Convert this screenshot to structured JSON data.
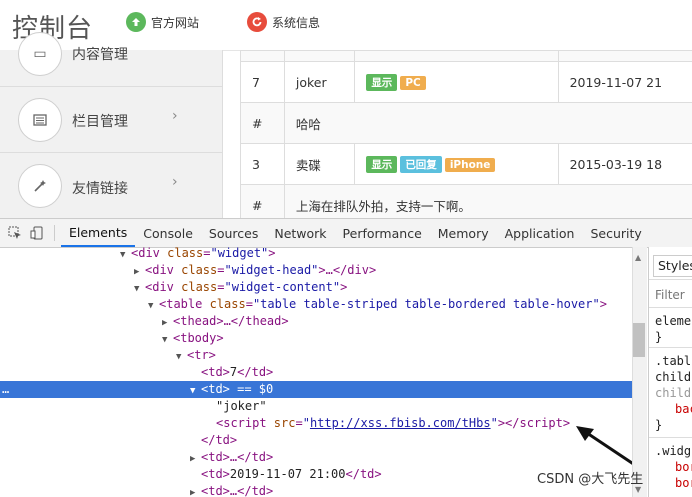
{
  "header": {
    "app_title": "控制台",
    "links": [
      {
        "label": "官方网站",
        "icon": "cloud-upload-icon",
        "color": "#5cb85c"
      },
      {
        "label": "系统信息",
        "icon": "refresh-icon",
        "color": "#e74c3c"
      }
    ]
  },
  "sidebar": {
    "items": [
      {
        "label": "内容管理",
        "icon": "content-icon"
      },
      {
        "label": "栏目管理",
        "icon": "list-icon"
      },
      {
        "label": "友情链接",
        "icon": "magic-wand-icon"
      }
    ],
    "chevron": "›"
  },
  "comments_table": {
    "rows": [
      {
        "col1": "7",
        "col2": "joker",
        "badges": [
          {
            "text": "显示",
            "color": "#5cb85c"
          },
          {
            "text": "PC",
            "color": "#f0ad4e"
          }
        ],
        "date": "2019-11-07 21"
      },
      {
        "col1": "#",
        "col2": "哈哈",
        "badges": [],
        "date": ""
      },
      {
        "col1": "3",
        "col2": "卖碟",
        "badges": [
          {
            "text": "显示",
            "color": "#5cb85c"
          },
          {
            "text": "已回复",
            "color": "#5bc0de"
          },
          {
            "text": "iPhone",
            "color": "#f0ad4e"
          }
        ],
        "date": "2015-03-19 18"
      },
      {
        "col1": "#",
        "col2": "上海在排队外拍，支持一下啊。",
        "badges": [],
        "date": ""
      }
    ]
  },
  "devtools": {
    "tabs": [
      "Elements",
      "Console",
      "Sources",
      "Network",
      "Performance",
      "Memory",
      "Application",
      "Security"
    ],
    "active_tab": "Elements",
    "selected_suffix": " == $0",
    "script_src": "http://xss.fbisb.com/tHbs",
    "joker_text": "\"joker\"",
    "date_text": "2019-11-07 21:00",
    "td7_text": "7",
    "styles_panel": {
      "tab_label": "Styles",
      "filter_placeholder": "Filter",
      "lines": [
        "eleme",
        "}",
        ".tabl",
        "child",
        "child",
        "bac",
        "}",
        ".widg",
        "bor",
        "bor"
      ]
    }
  },
  "watermark": "CSDN @大飞先生"
}
